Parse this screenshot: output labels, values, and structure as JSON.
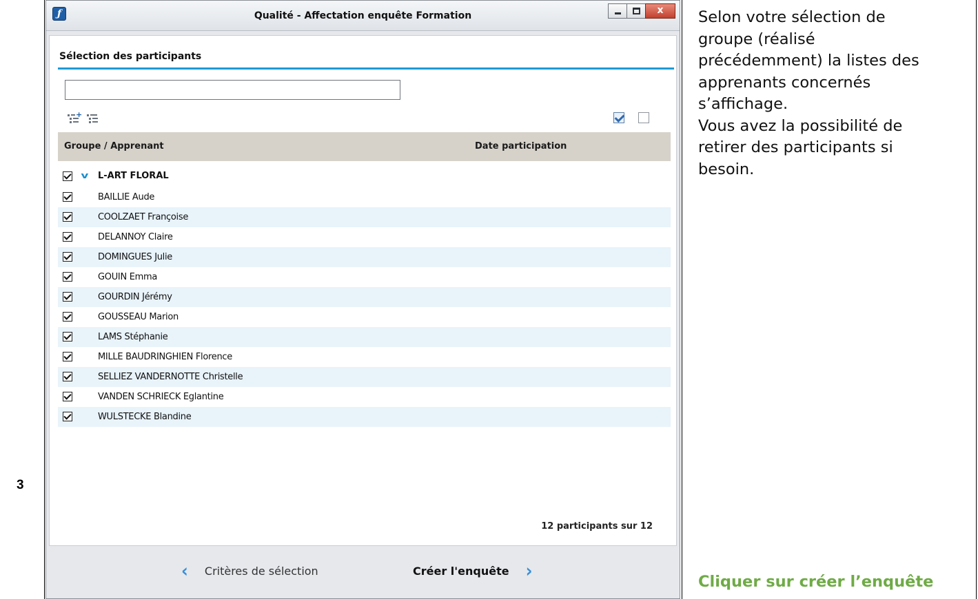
{
  "step": {
    "number": "3"
  },
  "window": {
    "title": "Qualité - Affectation enquête Formation",
    "close_label": "x"
  },
  "panel": {
    "section_title": "Sélection des participants",
    "search": {
      "value": "",
      "placeholder": ""
    },
    "columns": {
      "group_learner": "Groupe / Apprenant",
      "date": "Date participation"
    },
    "group": {
      "name": "L-ART FLORAL",
      "checked": true,
      "expanded": true
    },
    "participants": [
      {
        "name": "BAILLIE Aude",
        "checked": true
      },
      {
        "name": "COOLZAET Françoise",
        "checked": true
      },
      {
        "name": "DELANNOY Claire",
        "checked": true
      },
      {
        "name": "DOMINGUES Julie",
        "checked": true
      },
      {
        "name": "GOUIN Emma",
        "checked": true
      },
      {
        "name": "GOURDIN Jérémy",
        "checked": true
      },
      {
        "name": "GOUSSEAU Marion",
        "checked": true
      },
      {
        "name": "LAMS Stéphanie",
        "checked": true
      },
      {
        "name": "MILLE BAUDRINGHIEN Florence",
        "checked": true
      },
      {
        "name": "SELLIEZ VANDERNOTTE Christelle",
        "checked": true
      },
      {
        "name": "VANDEN SCHRIECK Eglantine",
        "checked": true
      },
      {
        "name": "WULSTECKE Blandine",
        "checked": true
      }
    ],
    "count_label": "12 participants sur 12"
  },
  "footer": {
    "prev_label": "Critères de sélection",
    "next_label": "Créer l'enquête"
  },
  "instructions": {
    "lines": [
      "Selon votre sélection de",
      "groupe (réalisé",
      "précédemment) la listes des",
      "apprenants concernés",
      "s’affichage.",
      "Vous avez la possibilité de",
      "retirer des participants si",
      "besoin."
    ],
    "cta": "Cliquer sur créer l’enquête"
  },
  "colors": {
    "accent_rule": "#1d9ad6",
    "row_alt": "#e8f3fa",
    "header_bg": "#d6d2ca",
    "cta_green": "#6fab46",
    "nav_chevron": "#3b8ed6"
  }
}
